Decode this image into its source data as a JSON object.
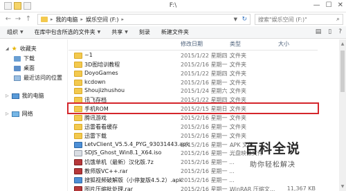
{
  "window": {
    "title": "F:\\"
  },
  "address": {
    "crumbs": [
      "我的电脑",
      "娱乐空间 (F:)"
    ]
  },
  "search": {
    "placeholder": "搜索\"娱乐空间 (F:)\""
  },
  "toolbar": {
    "organize": "组织",
    "include_in_library": "在库中包含所选的文件夹",
    "share": "共享",
    "burn": "刻录",
    "new_folder": "新建文件夹"
  },
  "sidebar": {
    "favorites": "收藏夹",
    "downloads": "下载",
    "desktop": "桌面",
    "recent": "最近访问的位置",
    "computer": "我的电脑",
    "network": "网络"
  },
  "columns": {
    "date": "修改日期",
    "type": "类型",
    "size": "大小"
  },
  "files": [
    {
      "name": "~1",
      "date": "2015/1/22 星期四 ...",
      "type": "文件夹",
      "size": "",
      "icon": "folder"
    },
    {
      "name": "3D图培训教程",
      "date": "2015/2/16 星期一 ...",
      "type": "文件夹",
      "size": "",
      "icon": "folder"
    },
    {
      "name": "DoyoGames",
      "date": "2015/1/22 星期四 ...",
      "type": "文件夹",
      "size": "",
      "icon": "folder"
    },
    {
      "name": "kcdown",
      "date": "2015/2/16 星期一 ...",
      "type": "文件夹",
      "size": "",
      "icon": "folder"
    },
    {
      "name": "Shoujizhushou",
      "date": "2015/1/24 星期六 ...",
      "type": "文件夹",
      "size": "",
      "icon": "folder"
    },
    {
      "name": "讯飞存档",
      "date": "2015/1/22 星期四 ...",
      "type": "文件夹",
      "size": "",
      "icon": "folder"
    },
    {
      "name": "手机ROM",
      "date": "2015/2/15 星期日 ...",
      "type": "文件夹",
      "size": "",
      "icon": "folder"
    },
    {
      "name": "腾讯游戏",
      "date": "2015/2/16 星期一 ...",
      "type": "文件夹",
      "size": "",
      "icon": "folder"
    },
    {
      "name": "迅雷看看缓存",
      "date": "2015/2/16 星期一 ...",
      "type": "文件夹",
      "size": "",
      "icon": "folder"
    },
    {
      "name": "迅雷下载",
      "date": "2015/2/16 星期一 ...",
      "type": "文件夹",
      "size": "",
      "icon": "folder"
    },
    {
      "name": "LetvClient_V5.5.4_PYG_93031443.apk",
      "date": "2015/2/16 星期一 ...",
      "type": "APK 文件",
      "size": "",
      "icon": "app"
    },
    {
      "name": "SDJS_Ghost_Win8.1_X64.iso",
      "date": "2015/2/16 星期一 ...",
      "type": "光盘映像文件",
      "size": "",
      "icon": "iso"
    },
    {
      "name": "饥饿单机（最新）汉化版.7z",
      "date": "2015/2/16 星期一 ...",
      "type": "",
      "size": "",
      "icon": "rar"
    },
    {
      "name": "教师版VC++.rar",
      "date": "2015/2/16 星期一 ...",
      "type": "",
      "size": "",
      "icon": "rar"
    },
    {
      "name": "搜狐视频破解版（小停复版4.5.2）.apk",
      "date": "2015/2/16 星期一 ...",
      "type": "",
      "size": "",
      "icon": "app"
    },
    {
      "name": "图片压缩批处理.rar",
      "date": "2015/2/16 星期一 ...",
      "type": "WinRAR 压缩文...",
      "size": "11,367 KB",
      "icon": "rar"
    }
  ],
  "watermark": {
    "big": "百科全说",
    "small": "助你轻松解决"
  }
}
